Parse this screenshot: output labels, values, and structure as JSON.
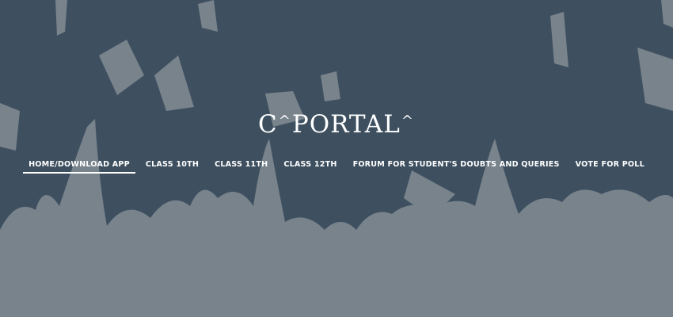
{
  "brand": {
    "logo_left": "C",
    "logo_mark": "^",
    "logo_text": "PORTAL"
  },
  "nav": {
    "items": [
      {
        "label": "HOME/DOWNLOAD APP",
        "active": true
      },
      {
        "label": "CLASS 10TH"
      },
      {
        "label": "CLASS 11TH"
      },
      {
        "label": "CLASS 12TH"
      },
      {
        "label": "FORUM FOR STUDENT'S DOUBTS AND QUERIES"
      },
      {
        "label": "VOTE FOR POLL"
      }
    ]
  },
  "colors": {
    "background": "#3e5060",
    "silhouette": "#a9adb1",
    "text": "#ffffff"
  },
  "background_image": "graduation-crowd-throwing-caps"
}
